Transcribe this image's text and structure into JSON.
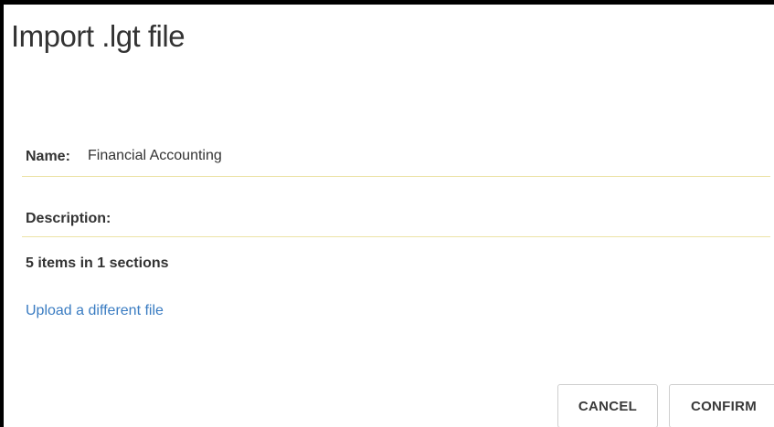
{
  "dialog": {
    "title": "Import .lgt file"
  },
  "form": {
    "name_label": "Name:",
    "name_value": "Financial Accounting",
    "description_label": "Description:",
    "description_value": ""
  },
  "summary": "5 items in 1 sections",
  "upload_link": "Upload a different file",
  "actions": {
    "cancel_label": "CANCEL",
    "confirm_label": "CONFIRM"
  },
  "colors": {
    "link": "#3a7cc2",
    "field_underline": "#ece3a6",
    "text": "#333333"
  }
}
